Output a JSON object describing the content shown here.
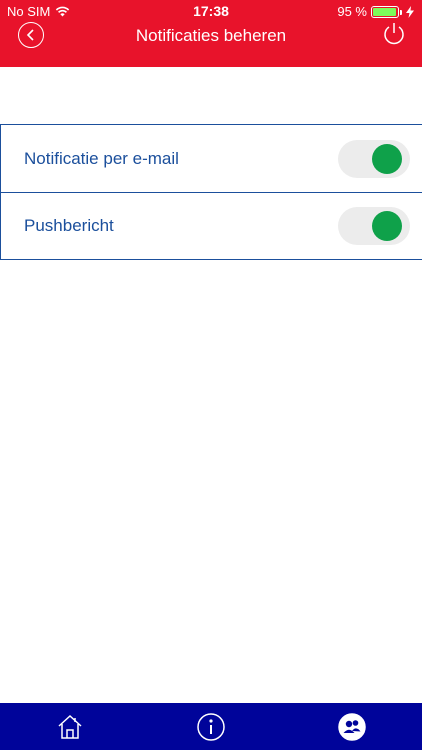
{
  "status_bar": {
    "carrier": "No SIM",
    "time": "17:38",
    "battery_percent": "95 %",
    "battery_level": 0.95,
    "icons": [
      "wifi-icon",
      "battery-icon",
      "charging-icon"
    ]
  },
  "header": {
    "title": "Notificaties beheren",
    "back_icon": "chevron-left-icon",
    "power_icon": "power-icon",
    "background_color": "#e8132b"
  },
  "settings": {
    "items": [
      {
        "label": "Notificatie per e-mail",
        "enabled": true
      },
      {
        "label": "Pushbericht",
        "enabled": true
      }
    ],
    "accent_color": "#1b4f9c",
    "toggle_on_color": "#0fa14a"
  },
  "tabbar": {
    "background_color": "#00049a",
    "tabs": [
      {
        "icon": "home-icon"
      },
      {
        "icon": "info-icon"
      },
      {
        "icon": "users-icon"
      }
    ]
  }
}
